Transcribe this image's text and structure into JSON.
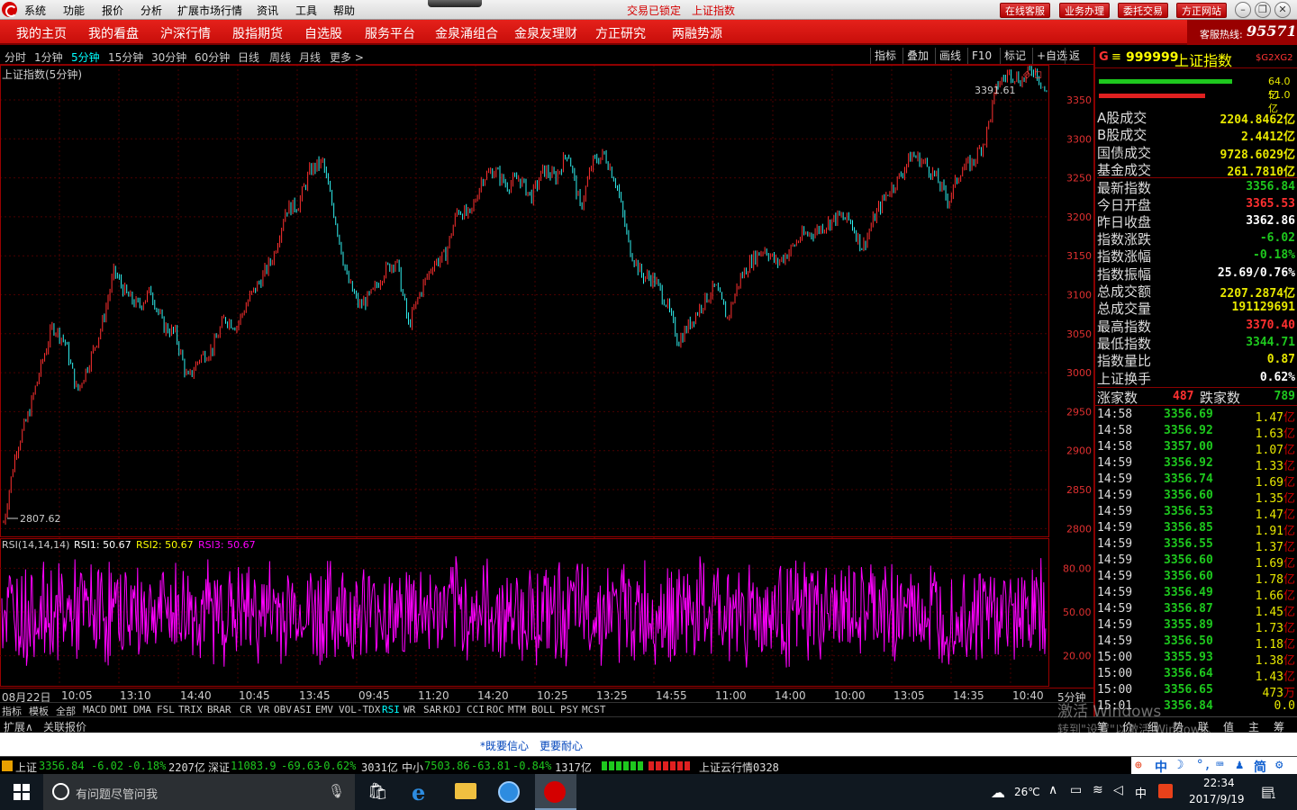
{
  "menubar": {
    "items": [
      "系统",
      "功能",
      "报价",
      "分析",
      "扩展市场行情",
      "资讯",
      "工具",
      "帮助"
    ],
    "status_lock": "交易已锁定",
    "status_index": "上证指数",
    "buttons": [
      "在线客服",
      "业务办理",
      "委托交易",
      "方正网站"
    ]
  },
  "navbar": {
    "items": [
      "我的主页",
      "我的看盘",
      "沪深行情",
      "股指期货",
      "自选股",
      "服务平台",
      "金泉涌组合",
      "金泉友理财",
      "方正研究",
      "两融势源"
    ],
    "hotline_label": "客服热线:",
    "hotline_number": "95571"
  },
  "periods": {
    "items": [
      "分时",
      "1分钟",
      "5分钟",
      "15分钟",
      "30分钟",
      "60分钟",
      "日线",
      "周线",
      "月线",
      "更多 >"
    ],
    "active_index": 2,
    "tools": [
      "指标",
      "叠加",
      "画线",
      "F10",
      "标记",
      "+自选",
      "返回"
    ]
  },
  "main_chart": {
    "title": "上证指数(5分钟)",
    "high_label": "3391.61",
    "low_label": "2807.62",
    "y_ticks": [
      "3350",
      "3300",
      "3250",
      "3200",
      "3150",
      "3100",
      "3050",
      "3000",
      "2950",
      "2900",
      "2850",
      "2800"
    ],
    "colors": {
      "up": "#ff3030",
      "down": "#30f0f0",
      "grid": "#4a0000",
      "axis": "#900"
    }
  },
  "chart_data": [
    {
      "type": "line",
      "title": "上证指数(5分钟)",
      "ylim": [
        2790,
        3395
      ],
      "series": [
        {
          "values": [
            2807.62,
            2900,
            2945,
            3005,
            3060,
            3040,
            2975,
            3015,
            3060,
            3130,
            3100,
            3085,
            3105,
            3060,
            3050,
            2990,
            3020,
            3030,
            3070,
            3060,
            3095,
            3120,
            3150,
            3210,
            3215,
            3260,
            3270,
            3200,
            3120,
            3085,
            3100,
            3130,
            3145,
            3060,
            3105,
            3140,
            3150,
            3210,
            3200,
            3250,
            3260,
            3240,
            3250,
            3225,
            3260,
            3250,
            3285,
            3210,
            3270,
            3280,
            3240,
            3160,
            3125,
            3120,
            3090,
            3040,
            3065,
            3090,
            3110,
            3070,
            3120,
            3145,
            3160,
            3140,
            3155,
            3175,
            3180,
            3190,
            3200,
            3195,
            3160,
            3200,
            3230,
            3250,
            3280,
            3270,
            3250,
            3220,
            3260,
            3270,
            3300,
            3370,
            3385,
            3375,
            3391.61,
            3356.84
          ]
        }
      ],
      "x_labels": [
        "08月22日",
        "10:05",
        "13:10",
        "14:40",
        "10:45",
        "13:45",
        "09:45",
        "11:20",
        "14:20",
        "10:25",
        "13:25",
        "14:55",
        "11:00",
        "14:00",
        "10:00",
        "13:05",
        "14:35",
        "10:40",
        "5分钟"
      ]
    },
    {
      "type": "line",
      "title": "RSI(14,14,14)",
      "ylim": [
        0,
        100
      ],
      "series": [
        {
          "name": "RSI1",
          "values": [
            50.67
          ]
        },
        {
          "name": "RSI2",
          "values": [
            50.67
          ]
        },
        {
          "name": "RSI3",
          "values": [
            50.67
          ]
        }
      ],
      "y_ticks": [
        "80.00",
        "50.00",
        "20.00"
      ]
    }
  ],
  "rsi": {
    "label": "RSI(14,14,14)",
    "rsi1": "RSI1: 50.67",
    "rsi2": "RSI2: 50.67",
    "rsi3": "RSI3: 50.67",
    "colors": {
      "rsi1": "#ffffff",
      "rsi2": "#ffff00",
      "rsi3": "#ff00ff"
    }
  },
  "indicator_tabs": [
    "指标",
    "模板",
    "全部",
    "MACD",
    "DMI",
    "DMA",
    "FSL",
    "TRIX",
    "BRAR",
    "CR",
    "VR",
    "OBV",
    "ASI",
    "EMV",
    "VOL-TDX",
    "RSI",
    "WR",
    "SAR",
    "KDJ",
    "CCI",
    "ROC",
    "MTM",
    "BOLL",
    "PSY",
    "MCST"
  ],
  "ext_tabs": [
    "扩展∧",
    "关联报价"
  ],
  "panel": {
    "code": "999999",
    "name": "上证指数",
    "tag": "$G2XG2",
    "bar1_pct": "64.0亿",
    "bar2_pct": "51.0亿",
    "rows": [
      {
        "k": "A股成交",
        "v": "2204.8462亿",
        "c": "#e8e800"
      },
      {
        "k": "B股成交",
        "v": "2.4412亿",
        "c": "#e8e800"
      },
      {
        "k": "国债成交",
        "v": "9728.6029亿",
        "c": "#e8e800"
      },
      {
        "k": "基金成交",
        "v": "261.7810亿",
        "c": "#e8e800"
      },
      {
        "k": "最新指数",
        "v": "3356.84",
        "c": "#1ec81e"
      },
      {
        "k": "今日开盘",
        "v": "3365.53",
        "c": "#ff3030"
      },
      {
        "k": "昨日收盘",
        "v": "3362.86",
        "c": "#ffffff"
      },
      {
        "k": "指数涨跌",
        "v": "-6.02",
        "c": "#1ec81e"
      },
      {
        "k": "指数涨幅",
        "v": "-0.18%",
        "c": "#1ec81e"
      },
      {
        "k": "指数振幅",
        "v": "25.69/0.76%",
        "c": "#ffffff"
      },
      {
        "k": "总成交额",
        "v": "2207.2874亿",
        "c": "#e8e800"
      },
      {
        "k": "总成交量",
        "v": "191129691",
        "c": "#e8e800"
      },
      {
        "k": "最高指数",
        "v": "3370.40",
        "c": "#ff3030"
      },
      {
        "k": "最低指数",
        "v": "3344.71",
        "c": "#1ec81e"
      },
      {
        "k": "指数量比",
        "v": "0.87",
        "c": "#e8e800"
      },
      {
        "k": "上证换手",
        "v": "0.62%",
        "c": "#ffffff"
      }
    ],
    "up_label": "涨家数",
    "up_count": "487",
    "down_label": "跌家数",
    "down_count": "789",
    "ticks": [
      {
        "t": "14:58",
        "p": "3356.69",
        "a": "1.47",
        "u": "亿"
      },
      {
        "t": "14:58",
        "p": "3356.92",
        "a": "1.63",
        "u": "亿"
      },
      {
        "t": "14:58",
        "p": "3357.00",
        "a": "1.07",
        "u": "亿"
      },
      {
        "t": "14:59",
        "p": "3356.92",
        "a": "1.33",
        "u": "亿"
      },
      {
        "t": "14:59",
        "p": "3356.74",
        "a": "1.69",
        "u": "亿"
      },
      {
        "t": "14:59",
        "p": "3356.60",
        "a": "1.35",
        "u": "亿"
      },
      {
        "t": "14:59",
        "p": "3356.53",
        "a": "1.47",
        "u": "亿"
      },
      {
        "t": "14:59",
        "p": "3356.85",
        "a": "1.91",
        "u": "亿"
      },
      {
        "t": "14:59",
        "p": "3356.55",
        "a": "1.37",
        "u": "亿"
      },
      {
        "t": "14:59",
        "p": "3356.60",
        "a": "1.69",
        "u": "亿"
      },
      {
        "t": "14:59",
        "p": "3356.60",
        "a": "1.78",
        "u": "亿"
      },
      {
        "t": "14:59",
        "p": "3356.49",
        "a": "1.66",
        "u": "亿"
      },
      {
        "t": "14:59",
        "p": "3356.87",
        "a": "1.45",
        "u": "亿"
      },
      {
        "t": "14:59",
        "p": "3355.89",
        "a": "1.73",
        "u": "亿"
      },
      {
        "t": "14:59",
        "p": "3356.50",
        "a": "1.18",
        "u": "亿"
      },
      {
        "t": "15:00",
        "p": "3355.93",
        "a": "1.38",
        "u": "亿"
      },
      {
        "t": "15:00",
        "p": "3356.64",
        "a": "1.43",
        "u": "亿"
      },
      {
        "t": "15:00",
        "p": "3356.65",
        "a": "473",
        "u": "万"
      },
      {
        "t": "15:01",
        "p": "3356.84",
        "a": "0.0",
        "u": ""
      }
    ],
    "tabs": [
      "笔",
      "价",
      "细",
      "势",
      "联",
      "值",
      "主",
      "筹"
    ]
  },
  "watermark": {
    "line1": "激活 Windows",
    "line2": "转到\"设置\"以激活 Windows。"
  },
  "promo": {
    "link1": "*既要信心",
    "link2": "更要耐心"
  },
  "ticker": {
    "sh_name": "上证",
    "sh_val": "3356.84",
    "sh_chg": "-6.02",
    "sh_pct": "-0.18%",
    "sh_amt": "2207亿",
    "sz_name": "深证",
    "sz_val": "11083.9",
    "sz_chg": "-69.63",
    "sz_pct": "-0.62%",
    "sz_amt": "3031亿",
    "zx_name": "中小",
    "zx_val": "7503.86",
    "zx_chg": "-63.81",
    "zx_pct": "-0.84%",
    "zx_amt": "1317亿",
    "cloud": "上证云行情0328"
  },
  "taskbar": {
    "search_placeholder": "有问题尽管问我",
    "weather": "26℃",
    "time": "22:34",
    "date": "2017/9/19",
    "ime": "中",
    "notify_count": "1"
  }
}
